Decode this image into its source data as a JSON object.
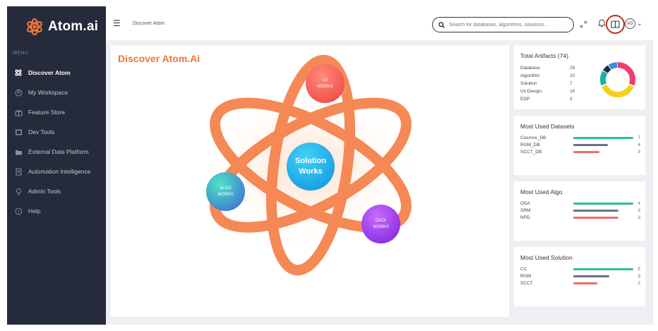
{
  "app": {
    "name": "Atom.ai"
  },
  "sidebar": {
    "menu_label": "MENU",
    "items": [
      {
        "label": "Discover Atom",
        "icon": "atom-icon",
        "active": true
      },
      {
        "label": "My Workspace",
        "icon": "workspace-icon",
        "active": false
      },
      {
        "label": "Feature Store",
        "icon": "gift-icon",
        "active": false
      },
      {
        "label": "Dev Tools",
        "icon": "devtools-icon",
        "active": false
      },
      {
        "label": "External Data Platform",
        "icon": "folder-icon",
        "active": false
      },
      {
        "label": "Automation Intelligence",
        "icon": "document-icon",
        "active": false
      },
      {
        "label": "Admin Tools",
        "icon": "bulb-icon",
        "active": false
      },
      {
        "label": "Help",
        "icon": "help-icon",
        "active": false
      }
    ]
  },
  "header": {
    "breadcrumb": "Discover Atom",
    "search_placeholder": "Search for databases, algorithms, solutions...",
    "avatar_initials": "VG"
  },
  "discover": {
    "title": "Discover Atom.Ai",
    "center_line1": "Solution",
    "center_line2": "Works",
    "ux_line1": "UX",
    "ux_line2": "WORKS",
    "algo_line1": "ALGO",
    "algo_line2": "WORKS",
    "data_line1": "DATA",
    "data_line2": "WORKS"
  },
  "artifacts": {
    "title": "Total Artifacts (74)",
    "rows": [
      {
        "label": "Database",
        "value": "28"
      },
      {
        "label": "Algorithm",
        "value": "20"
      },
      {
        "label": "Solution",
        "value": "7"
      },
      {
        "label": "Ux Design",
        "value": "16"
      },
      {
        "label": "EDP",
        "value": "3"
      }
    ]
  },
  "datasets": {
    "title": "Most Used Datasets",
    "rows": [
      {
        "label": "Cosmos_DB",
        "value": "7",
        "fill": 1.0,
        "color": "#2fbf8f"
      },
      {
        "label": "RGM_DB",
        "value": "4",
        "fill": 0.57,
        "color": "#6b7184"
      },
      {
        "label": "SCCT_DB",
        "value": "3",
        "fill": 0.43,
        "color": "#f06a6a"
      }
    ]
  },
  "algo": {
    "title": "Most Used Algo",
    "rows": [
      {
        "label": "OSA",
        "value": "4",
        "fill": 1.0,
        "color": "#2fbf8f"
      },
      {
        "label": "SRM",
        "value": "3",
        "fill": 0.75,
        "color": "#6b7184"
      },
      {
        "label": "NPD",
        "value": "3",
        "fill": 0.75,
        "color": "#f06a6a"
      }
    ]
  },
  "solution": {
    "title": "Most Used Solution",
    "rows": [
      {
        "label": "CC",
        "value": "5",
        "fill": 1.0,
        "color": "#2fbf8f"
      },
      {
        "label": "RGM",
        "value": "3",
        "fill": 0.6,
        "color": "#6b7184"
      },
      {
        "label": "SCCT",
        "value": "2",
        "fill": 0.4,
        "color": "#f06a6a"
      }
    ]
  },
  "colors": {
    "accent": "#f0743a",
    "sidebar": "#252b3b",
    "highlight_ring": "#b6321f"
  }
}
